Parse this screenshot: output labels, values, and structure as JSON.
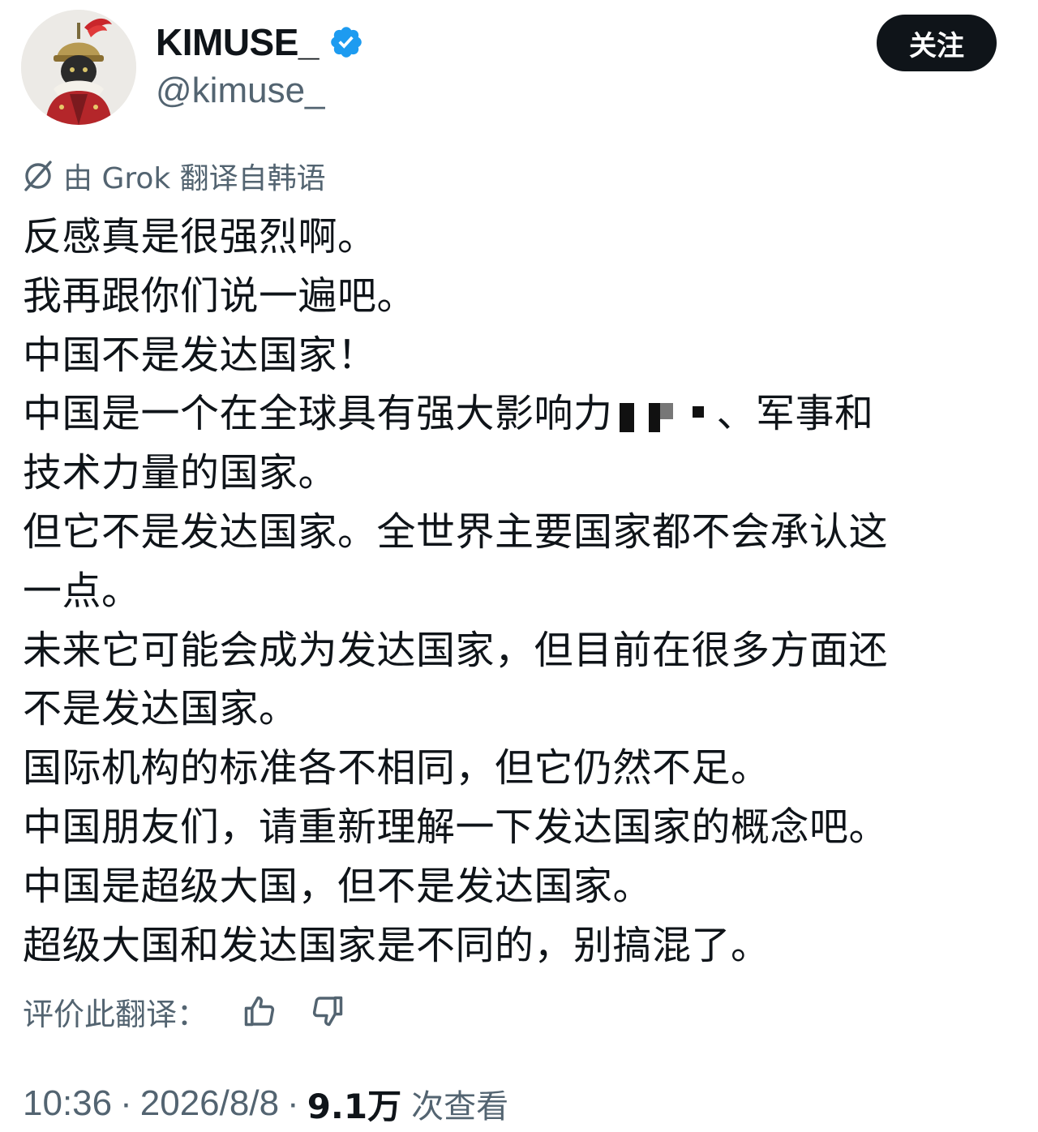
{
  "profile": {
    "display_name": "KIMUSE_",
    "handle": "@kimuse_",
    "verified_icon": "verified-badge-icon",
    "avatar": "avatar-helmeted-figure"
  },
  "header": {
    "follow_label": "关注"
  },
  "translation": {
    "note": "由 Grok 翻译自韩语",
    "icon": "translate-icon"
  },
  "tweet": {
    "lines": [
      "反感真是很强烈啊。",
      "我再跟你们说一遍吧。",
      "中国不是发达国家！",
      "中国是一个在全球具有强大影响力",
      "、军事和",
      "技术力量的国家。",
      "但它不是发达国家。全世界主要国家都不会承认这",
      "一点。",
      "未来它可能会成为发达国家，但目前在很多方面还",
      "不是发达国家。",
      "国际机构的标准各不相同，但它仍然不足。",
      "中国朋友们，请重新理解一下发达国家的概念吧。",
      "中国是超级大国，但不是发达国家。",
      "超级大国和发达国家是不同的，别搞混了。"
    ]
  },
  "rating": {
    "label": "评价此翻译：",
    "thumbs_up_icon": "thumbs-up-icon",
    "thumbs_down_icon": "thumbs-down-icon"
  },
  "meta": {
    "time": "10:36",
    "separator": "·",
    "date": "2026/8/8",
    "views_count": "9.1万",
    "views_label": "次查看"
  },
  "colors": {
    "text_primary": "#0f1419",
    "text_secondary": "#536471",
    "verified_blue": "#1d9bf0",
    "button_bg": "#0f1419"
  }
}
